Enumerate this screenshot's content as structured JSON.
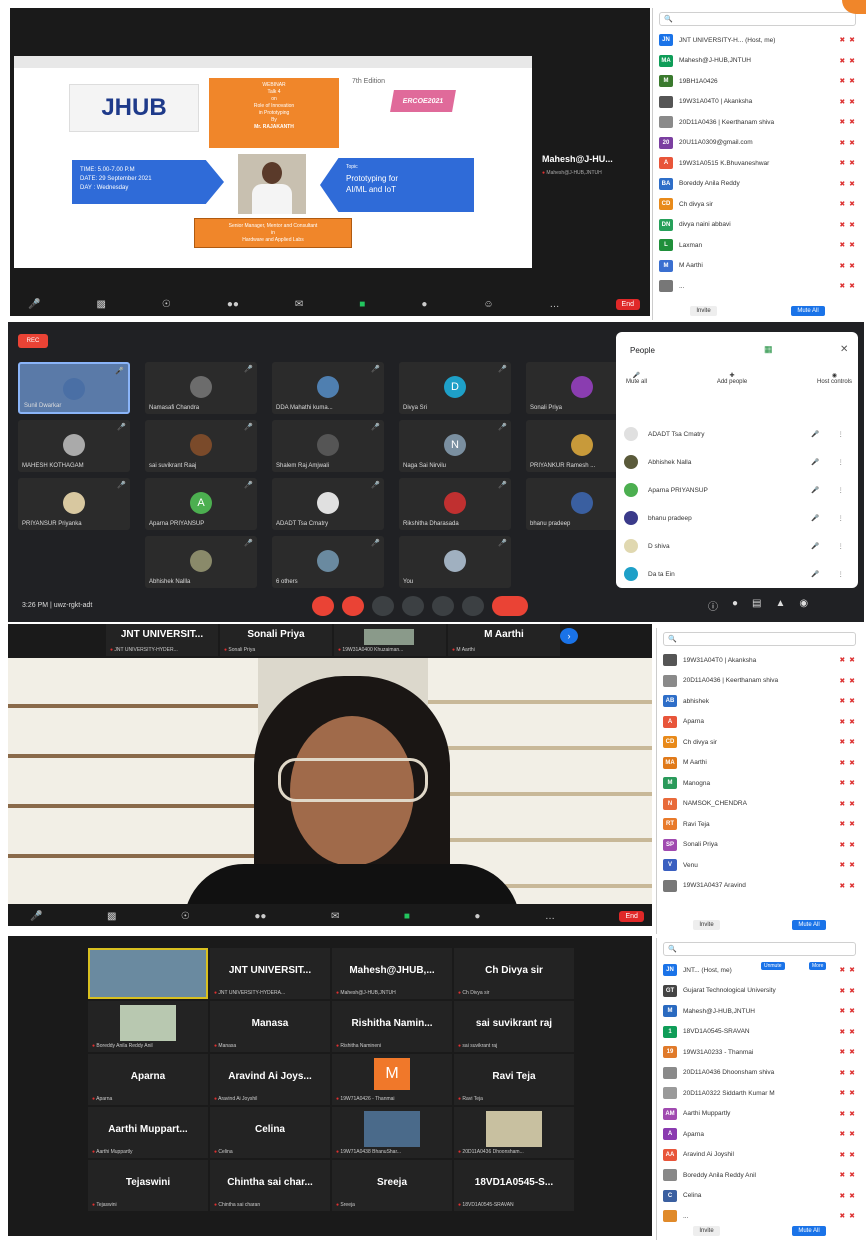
{
  "panel1": {
    "presenter_name": "Mahesh@J-HU...",
    "presenter_sub": "Mahesh@J-HUB,JNTUH",
    "slide": {
      "logo": "JHUB",
      "banner_lines": [
        "WEBINAR",
        "Talk 4",
        "on",
        "Role of Innovation",
        "in Prototyping",
        "By",
        "Mr. RAJAKANTH"
      ],
      "badge": "ERCOE2021",
      "edition": "7th Edition",
      "time_lines": [
        "TIME: 5.00-7.00 P.M",
        "DATE: 29 September 2021",
        "DAY : Wednesday"
      ],
      "topic_lines": [
        "Topic",
        "Prototyping for",
        "AI/ML and IoT"
      ],
      "role_lines": [
        "Senior Manager, Mentor and Consultant",
        "in",
        "Hardware and Applied Labs"
      ]
    },
    "end_label": "End",
    "participants": [
      {
        "initials": "JN",
        "name": "JNT UNIVERSITY-H... (Host, me)",
        "color": "#1a73e8"
      },
      {
        "initials": "MA",
        "name": "Mahesh@J-HUB,JNTUH",
        "color": "#0f9d58"
      },
      {
        "initials": "M",
        "name": "19BH1A0426",
        "color": "#3a7a2e"
      },
      {
        "initials": "",
        "name": "19W31A04T0 | Akanksha",
        "color": "#555555"
      },
      {
        "initials": "",
        "name": "20D11A0436 | Keerthanam shiva",
        "color": "#8a8a8a"
      },
      {
        "initials": "20",
        "name": "20U11A0309@gmail.com",
        "color": "#7b3fa0"
      },
      {
        "initials": "A",
        "name": "19W31A0515 K.Bhuvaneshwar",
        "color": "#e8553a"
      },
      {
        "initials": "BA",
        "name": "Boreddy Anila Reddy",
        "color": "#2e6ec8"
      },
      {
        "initials": "CD",
        "name": "Ch divya sir",
        "color": "#e88a1a"
      },
      {
        "initials": "DN",
        "name": "divya naini abbavi",
        "color": "#26a05a"
      },
      {
        "initials": "L",
        "name": "Laxman",
        "color": "#1f8f3a"
      },
      {
        "initials": "M",
        "name": "M Aarthi",
        "color": "#3a6fd0"
      },
      {
        "initials": "",
        "name": "...",
        "color": "#777777"
      }
    ],
    "btn_invite": "Invite",
    "btn_mute_all": "Mute All"
  },
  "panel2": {
    "rec_label": "REC",
    "tiles": [
      {
        "name": "Sunil Dwarkar",
        "initial": "",
        "color": "#4a6fa5",
        "photo": true
      },
      {
        "name": "Namasafi Chandra",
        "initial": "",
        "color": "#6c6c6c"
      },
      {
        "name": "DDA Mahathi kuma...",
        "initial": "",
        "color": "#4f7fb0"
      },
      {
        "name": "Divya Sri",
        "initial": "D",
        "color": "#1ea0c8"
      },
      {
        "name": "Sonali Priya",
        "initial": "",
        "color": "#8a3db0"
      },
      {
        "name": "MAHESH KOTHAGAM",
        "initial": "",
        "color": "#aaaaaa"
      },
      {
        "name": "sai suvikrant Raaj",
        "initial": "",
        "color": "#7a4a2a"
      },
      {
        "name": "Shalem Raj Amjwali",
        "initial": "",
        "color": "#555555"
      },
      {
        "name": "Naga Sai Nirvilu",
        "initial": "N",
        "color": "#7a8fa0"
      },
      {
        "name": "PRIYANKUR Ramesh ...",
        "initial": "",
        "color": "#c89a3a"
      },
      {
        "name": "PRIYANSUR Priyanka",
        "initial": "",
        "color": "#d8c8a0"
      },
      {
        "name": "Aparna PRIYANSUP",
        "initial": "A",
        "color": "#4caf50"
      },
      {
        "name": "ADADT Tsa Cmatry",
        "initial": "",
        "color": "#e0e0e0"
      },
      {
        "name": "Rikshitha Dharasada",
        "initial": "",
        "color": "#c03030"
      },
      {
        "name": "bhanu pradeep",
        "initial": "",
        "color": "#3a5fa0"
      },
      {
        "name": "Abhishek Nallla",
        "initial": "",
        "color": "#8a8a6a"
      },
      {
        "name": "6 others",
        "initial": "",
        "color": "#6a8aa0"
      },
      {
        "name": "You",
        "initial": "",
        "color": "#a0b0c0"
      }
    ],
    "time": "3:26 PM",
    "meeting_code": "uwz-rgkt-adt",
    "people": {
      "title": "People",
      "actions": [
        "Mute all",
        "Add people",
        "Host controls"
      ],
      "list": [
        {
          "name": "ADADT Tsa Cmatry",
          "color": "#e0e0e0"
        },
        {
          "name": "Abhishek Nalla",
          "color": "#5a5a3a"
        },
        {
          "name": "Aparna PRIYANSUP",
          "color": "#4caf50"
        },
        {
          "name": "bhanu pradeep",
          "color": "#3a3a8a"
        },
        {
          "name": "D shiva",
          "color": "#e0d8b0"
        },
        {
          "name": "Da ta Ein",
          "color": "#1ea0c8"
        }
      ]
    }
  },
  "panel3": {
    "top_tiles": [
      {
        "big": "JNT UNIVERSIT...",
        "small": "JNT UNIVERSITY-HYDER..."
      },
      {
        "big": "Sonali Priya",
        "small": "Sonali Priya"
      },
      {
        "big": "",
        "small": "19W31A0400 Khuzaiman..."
      },
      {
        "big": "M Aarthi",
        "small": "M Aarthi"
      }
    ],
    "end_label": "End",
    "participants": [
      {
        "initials": "",
        "name": "19W31A04T0 | Akanksha",
        "color": "#555555"
      },
      {
        "initials": "",
        "name": "20D11A0436 | Keerthanam shiva",
        "color": "#8a8a8a"
      },
      {
        "initials": "AB",
        "name": "abhishek",
        "color": "#2e6ec8"
      },
      {
        "initials": "A",
        "name": "Aparna",
        "color": "#e8553a"
      },
      {
        "initials": "CD",
        "name": "Ch divya sir",
        "color": "#e88a1a"
      },
      {
        "initials": "MA",
        "name": "M Aarthi",
        "color": "#e07a1a"
      },
      {
        "initials": "M",
        "name": "Manogna",
        "color": "#2a9a5a"
      },
      {
        "initials": "N",
        "name": "NAMSOK_CHENDRA",
        "color": "#e86a3a"
      },
      {
        "initials": "RT",
        "name": "Ravi Teja",
        "color": "#e87a2a"
      },
      {
        "initials": "SP",
        "name": "Sonali Priya",
        "color": "#a04ab0"
      },
      {
        "initials": "V",
        "name": "Venu",
        "color": "#3a5fc0"
      },
      {
        "initials": "",
        "name": "19W31A0437 Aravind",
        "color": "#777777"
      }
    ],
    "btn_invite": "Invite",
    "btn_mute_all": "Mute All"
  },
  "panel4": {
    "tiles": [
      {
        "big": "",
        "small": "",
        "photo": true
      },
      {
        "big": "JNT UNIVERSIT...",
        "small": "JNT UNIVERSITY-HYDERA..."
      },
      {
        "big": "Mahesh@JHUB,...",
        "small": "Mahesh@J-HUB,JNTUH"
      },
      {
        "big": "Ch Divya sir",
        "small": "Ch Divya sir"
      },
      {
        "big": "",
        "small": "Boreddy Anila Reddy Anil",
        "photo2": true
      },
      {
        "big": "Manasa",
        "small": "Manasa"
      },
      {
        "big": "Rishitha Namin...",
        "small": "Rishitha Namineni"
      },
      {
        "big": "sai suvikrant raj",
        "small": "sai suvikrant raj"
      },
      {
        "big": "Aparna",
        "small": "Aparna"
      },
      {
        "big": "Aravind Ai Joys...",
        "small": "Aravind Ai Joyshil"
      },
      {
        "big": "M",
        "small": "19W71A0426 - Thanmai",
        "orange": true
      },
      {
        "big": "Ravi Teja",
        "small": "Ravi Teja"
      },
      {
        "big": "Aarthi Muppart...",
        "small": "Aarthi Muppartly"
      },
      {
        "big": "Celina",
        "small": "Celina"
      },
      {
        "big": "",
        "small": "19W71A0438 BhanuShar...",
        "photo3": true
      },
      {
        "big": "",
        "small": "20D11A0436 Dhoonsham...",
        "photo4": true
      },
      {
        "big": "Tejaswini",
        "small": "Tejaswini"
      },
      {
        "big": "Chintha sai char...",
        "small": "Chintha sai charan"
      },
      {
        "big": "Sreeja",
        "small": "Sreeja"
      },
      {
        "big": "18VD1A0545-S...",
        "small": "18VD1A0545-SRAVAN"
      }
    ],
    "participants": [
      {
        "initials": "JN",
        "name": "JNT... (Host, me)",
        "color": "#1a73e8"
      },
      {
        "initials": "GT",
        "name": "Gujarat Technological University",
        "color": "#444444"
      },
      {
        "initials": "M",
        "name": "Mahesh@J-HUB,JNTUH",
        "color": "#2a6ac0"
      },
      {
        "initials": "1",
        "name": "18VD1A0545-SRAVAN",
        "color": "#0f9d58"
      },
      {
        "initials": "19",
        "name": "19W31A0233 - Thanmai",
        "color": "#e07a2a"
      },
      {
        "initials": "",
        "name": "20D11A0436 Dhoonsham shiva",
        "color": "#8a8a8a"
      },
      {
        "initials": "",
        "name": "20D11A0322 Siddarth Kumar M",
        "color": "#9a9a9a"
      },
      {
        "initials": "AM",
        "name": "Aarthi Muppartly",
        "color": "#a04ab0"
      },
      {
        "initials": "A",
        "name": "Aparna",
        "color": "#8a3ab0"
      },
      {
        "initials": "AA",
        "name": "Aravind Ai Joyshil",
        "color": "#e8553a"
      },
      {
        "initials": "",
        "name": "Boreddy Anila Reddy Anil",
        "color": "#888888"
      },
      {
        "initials": "C",
        "name": "Celina",
        "color": "#3a5fa0"
      },
      {
        "initials": "",
        "name": "...",
        "color": "#e08a2a"
      }
    ],
    "host_badges": [
      "Unmute",
      "More"
    ],
    "btn_invite": "Invite",
    "btn_mute_all": "Mute All"
  },
  "colors": {
    "zoom_dark": "#1a1a1a",
    "end_red": "#e02828",
    "meet_red": "#ea4335",
    "accent_blue": "#1a73e8"
  }
}
